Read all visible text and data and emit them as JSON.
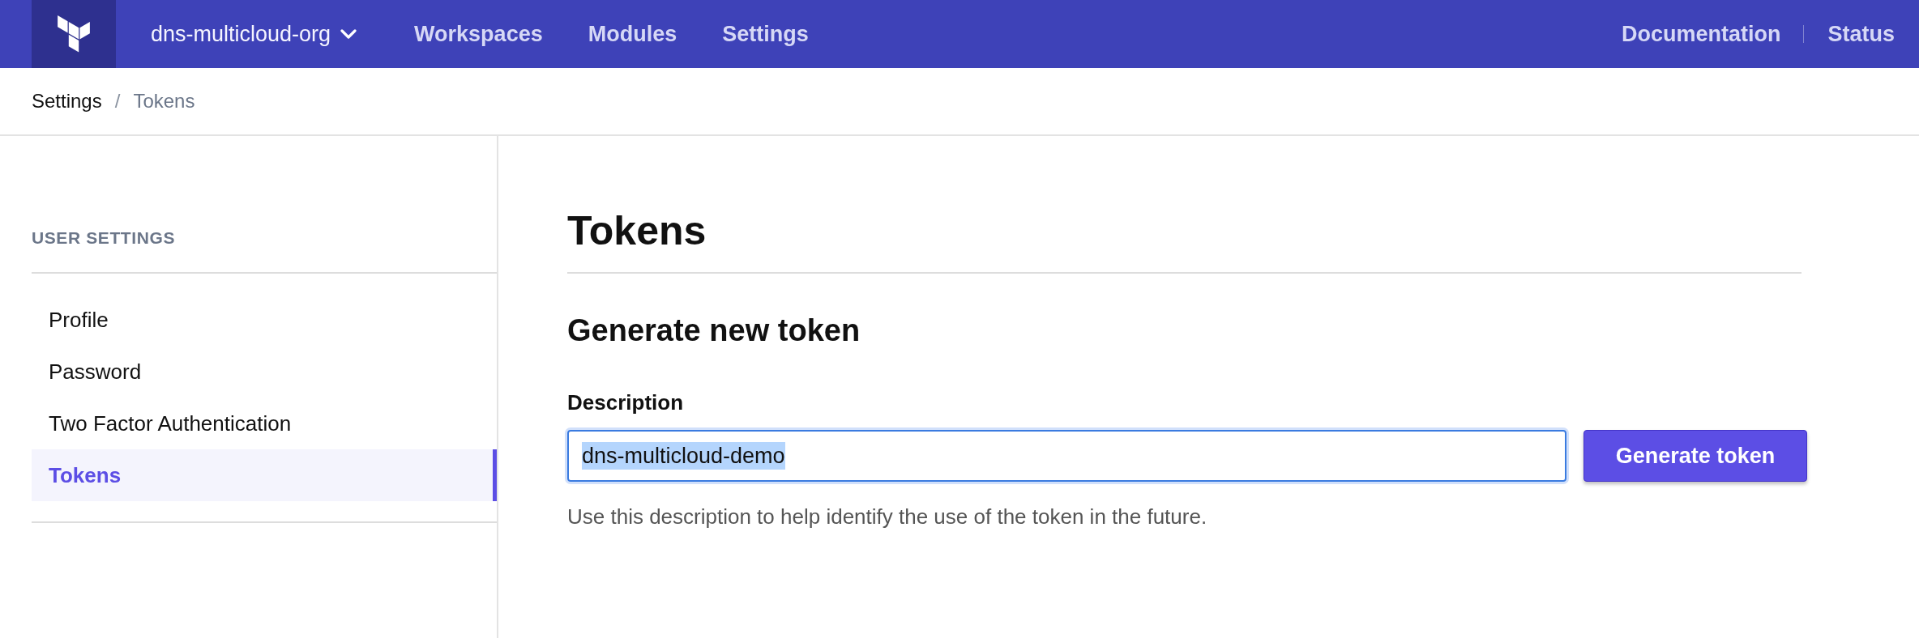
{
  "topbar": {
    "org_switcher": {
      "label": "dns-multicloud-org"
    },
    "nav": [
      {
        "label": "Workspaces"
      },
      {
        "label": "Modules"
      },
      {
        "label": "Settings"
      }
    ],
    "links": [
      {
        "label": "Documentation"
      },
      {
        "label": "Status"
      }
    ]
  },
  "breadcrumb": {
    "separator": "/",
    "items": [
      {
        "label": "Settings",
        "current": false
      },
      {
        "label": "Tokens",
        "current": true
      }
    ]
  },
  "sidebar": {
    "heading": "USER SETTINGS",
    "items": [
      {
        "label": "Profile",
        "selected": false
      },
      {
        "label": "Password",
        "selected": false
      },
      {
        "label": "Two Factor Authentication",
        "selected": false
      },
      {
        "label": "Tokens",
        "selected": true
      }
    ]
  },
  "main": {
    "title": "Tokens",
    "section_title": "Generate new token",
    "field": {
      "label": "Description",
      "value": "dns-multicloud-demo",
      "focused": true,
      "value_selected": true,
      "help": "Use this description to help identify the use of the token in the future."
    },
    "button": {
      "label": "Generate token"
    }
  }
}
